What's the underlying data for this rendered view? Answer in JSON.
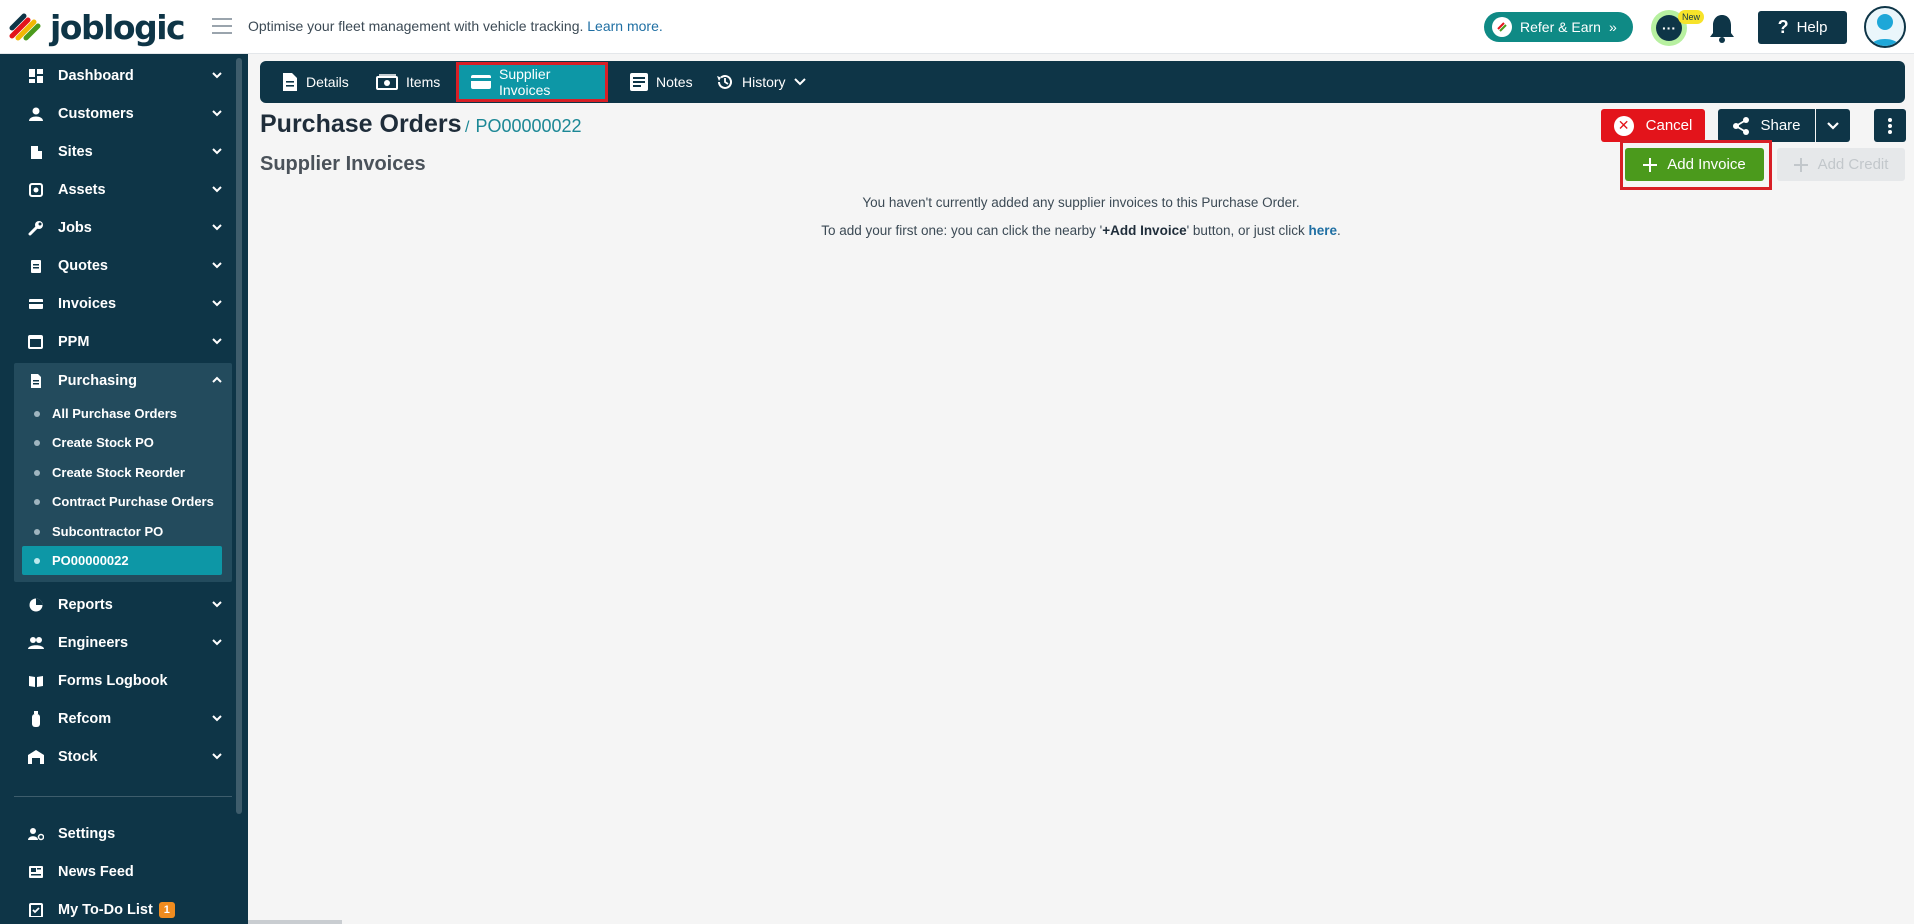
{
  "app": {
    "logo_text": "joblogic",
    "tagline": "Optimise your fleet management with vehicle tracking.",
    "tagline_link": "Learn more."
  },
  "topbar": {
    "refer_label": "Refer & Earn",
    "new_badge": "New",
    "help_label": "Help"
  },
  "sidebar": {
    "items": [
      {
        "label": "Dashboard",
        "icon": "dashboard-icon"
      },
      {
        "label": "Customers",
        "icon": "person-icon"
      },
      {
        "label": "Sites",
        "icon": "building-icon"
      },
      {
        "label": "Assets",
        "icon": "asset-icon"
      },
      {
        "label": "Jobs",
        "icon": "wrench-icon"
      },
      {
        "label": "Quotes",
        "icon": "clipboard-icon"
      },
      {
        "label": "Invoices",
        "icon": "card-icon"
      },
      {
        "label": "PPM",
        "icon": "calendar-icon"
      },
      {
        "label": "Purchasing",
        "icon": "document-icon"
      },
      {
        "label": "Reports",
        "icon": "pie-icon"
      },
      {
        "label": "Engineers",
        "icon": "people-icon"
      },
      {
        "label": "Forms Logbook",
        "icon": "book-icon"
      },
      {
        "label": "Refcom",
        "icon": "cylinder-icon"
      },
      {
        "label": "Stock",
        "icon": "warehouse-icon"
      }
    ],
    "purchasing_sub": [
      "All Purchase Orders",
      "Create Stock PO",
      "Create Stock Reorder",
      "Contract Purchase Orders",
      "Subcontractor PO",
      "PO00000022"
    ],
    "bottom_items": [
      {
        "label": "Settings",
        "icon": "user-gear-icon"
      },
      {
        "label": "News Feed",
        "icon": "news-icon"
      },
      {
        "label": "My To-Do List",
        "icon": "checklist-icon"
      }
    ],
    "todo_count": "1"
  },
  "tabs": [
    {
      "label": "Details",
      "icon": "document-icon"
    },
    {
      "label": "Items",
      "icon": "money-icon"
    },
    {
      "label": "Supplier Invoices",
      "icon": "card-icon"
    },
    {
      "label": "Notes",
      "icon": "notes-icon"
    },
    {
      "label": "History",
      "icon": "history-icon"
    }
  ],
  "header": {
    "title": "Purchase Orders",
    "crumb_sep": "/",
    "crumb": "PO00000022",
    "section": "Supplier Invoices"
  },
  "actions": {
    "cancel": "Cancel",
    "share": "Share",
    "add_invoice": "Add Invoice",
    "add_credit": "Add Credit"
  },
  "empty": {
    "line1": "You haven't currently added any supplier invoices to this Purchase Order.",
    "line2_pre": "To add your first one: you can click the nearby '",
    "line2_bold": "+Add Invoice",
    "line2_mid": "' button, or just click ",
    "line2_link": "here",
    "line2_end": "."
  },
  "colors": {
    "navy": "#0e3547",
    "teal": "#0d97a6",
    "green": "#4b9a1c",
    "red": "#e3141b",
    "highlight": "#d81f26"
  }
}
